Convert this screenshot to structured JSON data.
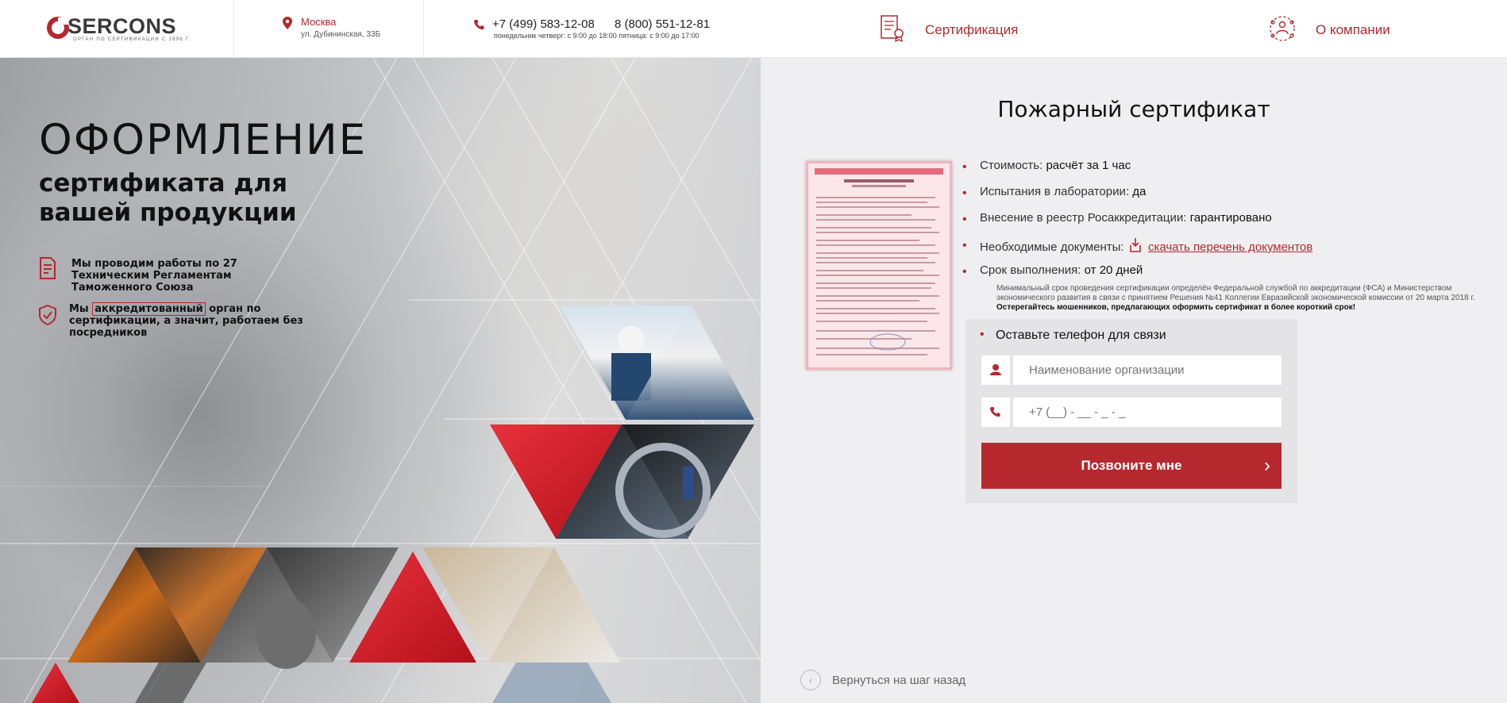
{
  "header": {
    "logo_text": "SERCONS",
    "logo_sub": "ОРГАН ПО СЕРТИФИКАЦИИ С 1996 Г.",
    "city": "Москва",
    "street": "ул. Дубининская, 33Б",
    "phone_1": "+7 (499) 583-12-08",
    "phone_2": "8 (800) 551-12-81",
    "hours": "понедельник четверг: с 9:00 до 18:00    пятница: с 9:00 до 17:00",
    "nav": [
      {
        "label": "Сертификация",
        "icon": "certificate-icon"
      },
      {
        "label": "О компании",
        "icon": "team-icon"
      }
    ]
  },
  "hero": {
    "title": "ОФОРМЛЕНИЕ",
    "subtitle": "сертификата для вашей продукции",
    "feature_1": "Мы проводим работы по 27 Техническим Регламентам Таможенного Союза",
    "feature_2_pre": "Мы",
    "feature_2_accent": "аккредитованный",
    "feature_2_post": "орган по сертификации, а значит, работаем без посредников",
    "feature_1_icon": "document-icon",
    "feature_2_icon": "shield-check-icon"
  },
  "panel": {
    "title": "Пожарный сертификат",
    "specs": [
      {
        "label": "Стоимость:",
        "value": "расчёт за 1 час"
      },
      {
        "label": "Испытания в лаборатории:",
        "value": "да"
      },
      {
        "label": "Внесение в реестр Росаккредитации:",
        "value": "гарантировано"
      },
      {
        "label": "Необходимые документы:",
        "value": "скачать перечень документов"
      },
      {
        "label": "Срок выполнения:",
        "value": "от 20 дней"
      }
    ],
    "note": "Минимальный срок проведения сертификации определён Федеральной службой по аккредитации (ФСА) и Министерством экономического развития в связи с принятием Решения №41 Коллегии Евразийской экономической комиссии от 20 марта 2018 г.",
    "note_bold": "Остерегайтесь мошенников, предлагающих оформить сертификат в более короткий срок!",
    "form": {
      "title": "Оставьте телефон для связи",
      "org_placeholder": "Наименование организации",
      "phone_placeholder": "+7 (__) - __ - _ - _",
      "submit": "Позвоните мне",
      "submit_icon": "chevron-right-icon"
    },
    "back": "Вернуться на шаг назад"
  },
  "colors": {
    "accent": "#b5282e",
    "panel_bg": "#efeff1",
    "form_bg": "#e4e4e6"
  }
}
